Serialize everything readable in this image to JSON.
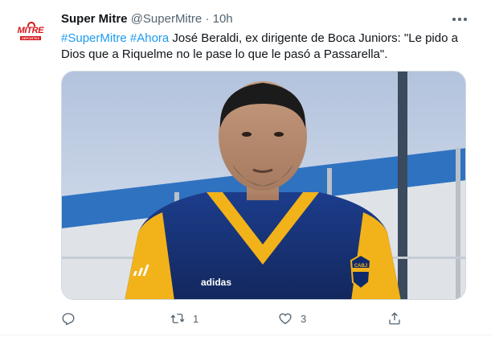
{
  "account": {
    "name": "Super Mitre",
    "handle": "@SuperMitre",
    "separator": "·",
    "time": "10h",
    "avatar_logo_text": "MITRE",
    "avatar_logo_subtext": "DEPORTES"
  },
  "tweet": {
    "hashtag_1": "#SuperMitre",
    "hashtag_2": "#Ahora",
    "body": " José Beraldi, ex dirigente de Boca Juniors: \"Le pido a Dios que a Riquelme no le pase lo que le pasó a Passarella\".",
    "media_kit_text": "adidas",
    "media_crest_text": "CABJ"
  },
  "actions": {
    "reply_count": "",
    "retweet_count": "1",
    "like_count": "3"
  },
  "icons": {
    "more": "more-icon",
    "reply": "reply-icon",
    "retweet": "retweet-icon",
    "like": "heart-icon",
    "share": "share-icon"
  },
  "colors": {
    "hashtag": "#1d9bf0",
    "secondary_text": "#536471",
    "brand_red": "#d7141a"
  }
}
